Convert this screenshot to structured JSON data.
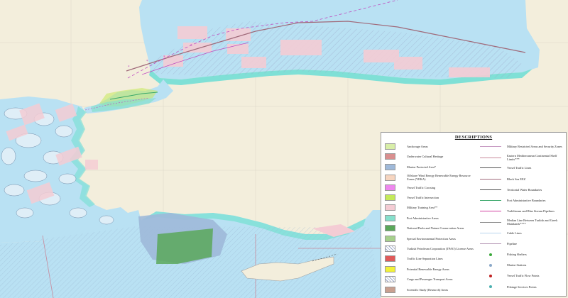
{
  "legend": {
    "title": "DESCRIPTIONS",
    "left_items": [
      {
        "label": "Anchorage Areas",
        "color": "#d8eea8"
      },
      {
        "label": "Underwater Cultural Heritage",
        "color": "#d98f8f"
      },
      {
        "label": "Marine Protected Area*",
        "color": "#9fb9d9"
      },
      {
        "label": "Offshore Wind Energy Renewable Energy Resource Zones (YEKA)",
        "color": "#f6d5c0"
      },
      {
        "label": "Vessel Traffic Crossing",
        "color": "#ee88ee"
      },
      {
        "label": "Vessel Traffic Intersection",
        "color": "#c4ea5a"
      },
      {
        "label": "Military Training Area**",
        "color": "#f4ccd4"
      },
      {
        "label": "Port Administrative Areas",
        "color": "#86e0cc"
      },
      {
        "label": "National Parks and Nature Conservation Areas",
        "color": "#5aa85a"
      },
      {
        "label": "Special Environmental Protection Areas",
        "color": "#a6d08c"
      },
      {
        "label": "Turkish Petroleum Corporation (TPAO) License Areas",
        "color": "#ffffff",
        "hatched": true
      },
      {
        "label": "Traffic Line Separation Lines",
        "color": "#e05a5a"
      },
      {
        "label": "Potential Renewable Energy Areas",
        "color": "#f2f23a"
      },
      {
        "label": "Cargo and Passenger Transport Areas",
        "color": "#ffffff",
        "hatched": true
      },
      {
        "label": "Scientific Study (Research) Areas",
        "color": "#c9a090"
      }
    ],
    "right_items": [
      {
        "label": "Military Restricted Areas and Security Zones",
        "symbol": "line",
        "color": "#c89cc4"
      },
      {
        "label": "Eastern Mediterranean Continental Shelf Limits***",
        "symbol": "line",
        "color": "#c88a9c"
      },
      {
        "label": "Vessel Traffic Lines",
        "symbol": "line",
        "color": "#555555"
      },
      {
        "label": "Black Sea EEZ",
        "symbol": "line",
        "color": "#a06a7a"
      },
      {
        "label": "Territorial Water Boundaries",
        "symbol": "line",
        "color": "#505050"
      },
      {
        "label": "Port Administrative Boundaries",
        "symbol": "line",
        "color": "#3aa86a"
      },
      {
        "label": "TurkStream and Blue Stream Pipelines",
        "symbol": "line",
        "color": "#d040a0"
      },
      {
        "label": "Median Line Between Turkish and Greek Mainlands****",
        "symbol": "line",
        "color": "#909090"
      },
      {
        "label": "Cable Lines",
        "symbol": "line",
        "color": "#b8d4ee"
      },
      {
        "label": "Pipeline",
        "symbol": "line",
        "color": "#b89ab8"
      },
      {
        "label": "Fishing Shelters",
        "symbol": "dot",
        "color": "#3aa83a"
      },
      {
        "label": "Marine Stations",
        "symbol": "dot",
        "color": "#8aa8c8"
      },
      {
        "label": "Vessel Traffic Flow Points",
        "symbol": "dot",
        "color": "#c02020"
      },
      {
        "label": "Pilotage Services Points",
        "symbol": "dot",
        "color": "#4ab0b0"
      }
    ]
  },
  "colors": {
    "land": "#f3eedc",
    "sea": "#b9e1f3",
    "coastal_band": "#7fe0d6",
    "military_area": "#f4ccd4",
    "marine_protected": "#9fb9d9",
    "national_park": "#5aa85a",
    "border_line": "#c88a9c",
    "traffic_line": "#c04ec0"
  }
}
